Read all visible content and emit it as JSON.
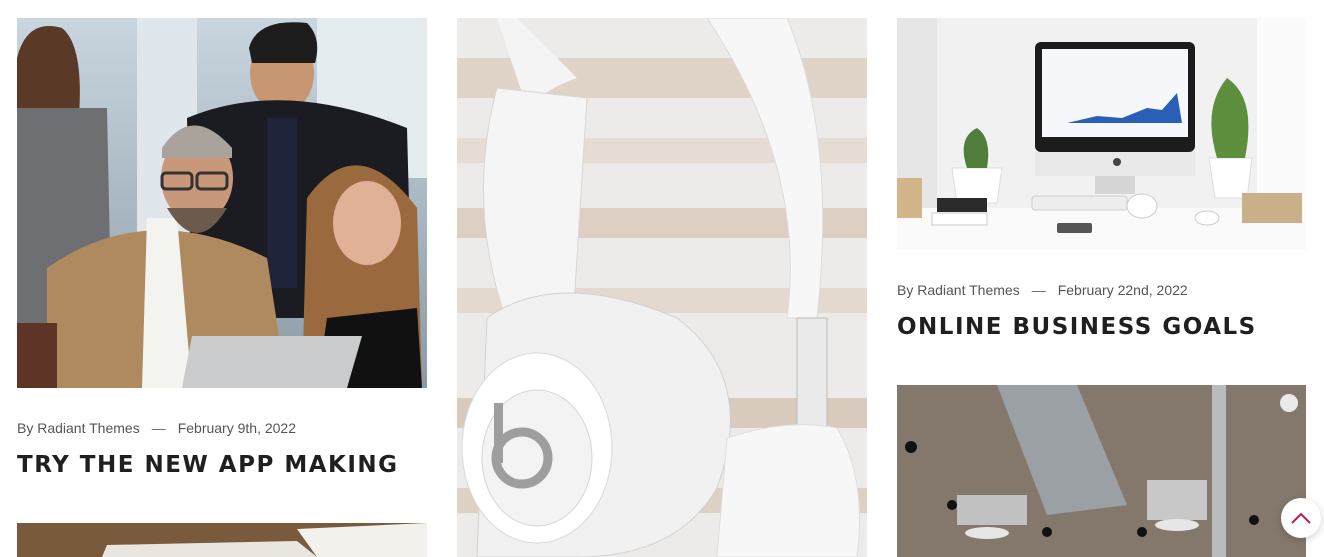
{
  "posts": [
    {
      "author": "By Radiant Themes",
      "separator": "—",
      "date": "February 9th, 2022",
      "title": "TRY THE NEW APP MAKING",
      "image": "business-team-laptop-photo"
    },
    {
      "image": "white-headphones-photo"
    },
    {
      "author": "By Radiant Themes",
      "separator": "—",
      "date": "February 22nd, 2022",
      "title": "ONLINE BUSINESS GOALS",
      "image": "desk-computer-workspace-photo"
    },
    {
      "image": "office-ceiling-photo"
    },
    {
      "image": "desk-papers-photo"
    }
  ],
  "scroll_top": {
    "icon": "chevron-up-icon",
    "color": "#c2185b"
  }
}
